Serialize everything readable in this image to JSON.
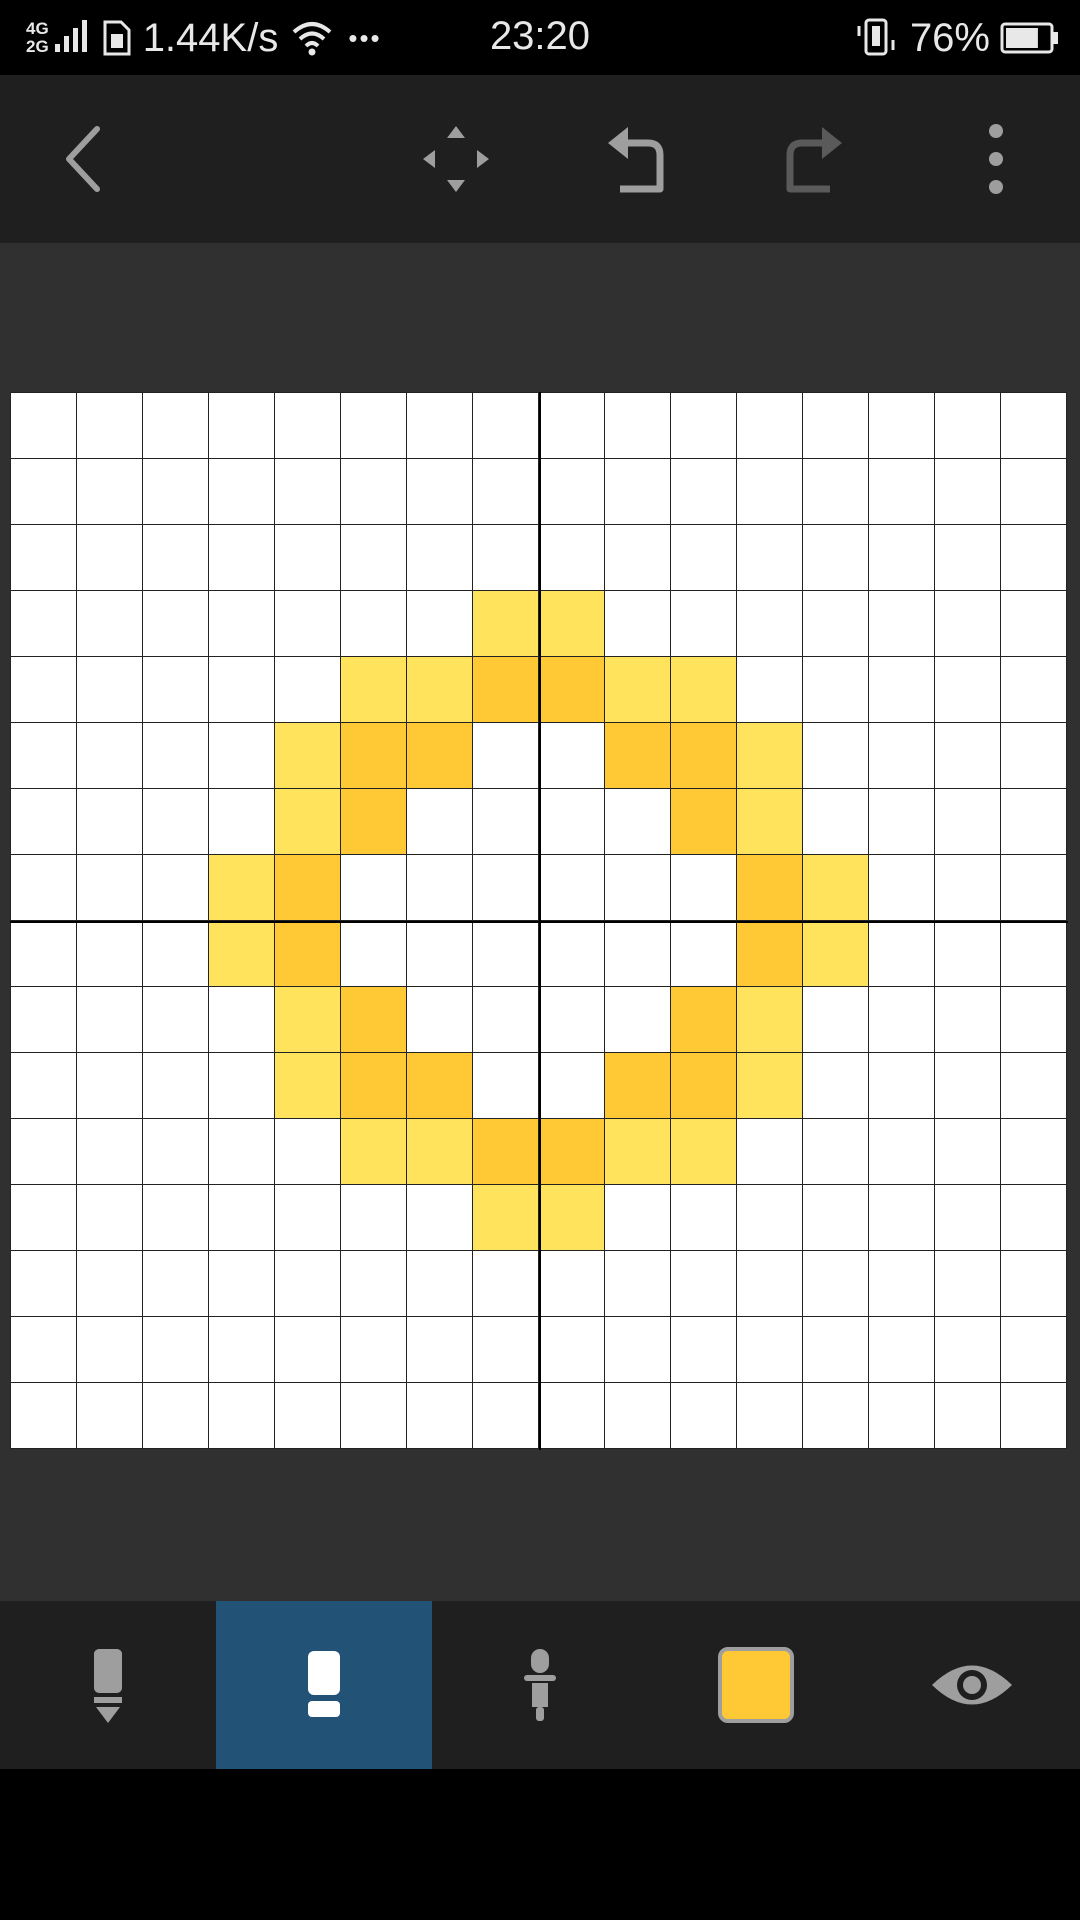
{
  "status_bar": {
    "network_types": [
      "4G",
      "2G"
    ],
    "speed": "1.44K/s",
    "more": "•••",
    "time": "23:20",
    "battery_percent": "76%",
    "battery_level": 0.76
  },
  "toolbar": {
    "icons": [
      "back-icon",
      "move-icon",
      "undo-icon",
      "redo-icon",
      "more-vert-icon"
    ],
    "redo_enabled": false
  },
  "canvas": {
    "grid_size": 16,
    "colors": {
      "light": "#FFE35C",
      "dark": "#FFC935",
      "empty": "#FFFFFF"
    },
    "pixels": [
      "................",
      "................",
      "................",
      ".......LL.......",
      ".....LLDDLL.....",
      "....LDD..DDL....",
      "....LD....DL....",
      "...LD......DL...",
      "...LD......DL...",
      "....LD....DL....",
      "....LDD..DDL....",
      ".....LLDDLL.....",
      ".......LL.......",
      "................",
      "................",
      "................"
    ]
  },
  "bottom_toolbar": {
    "tools": [
      "pencil-icon",
      "eraser-icon",
      "eyedropper-icon",
      "color-swatch",
      "eye-icon"
    ],
    "active_tool": "eraser-icon",
    "current_color": "#FFC935"
  }
}
